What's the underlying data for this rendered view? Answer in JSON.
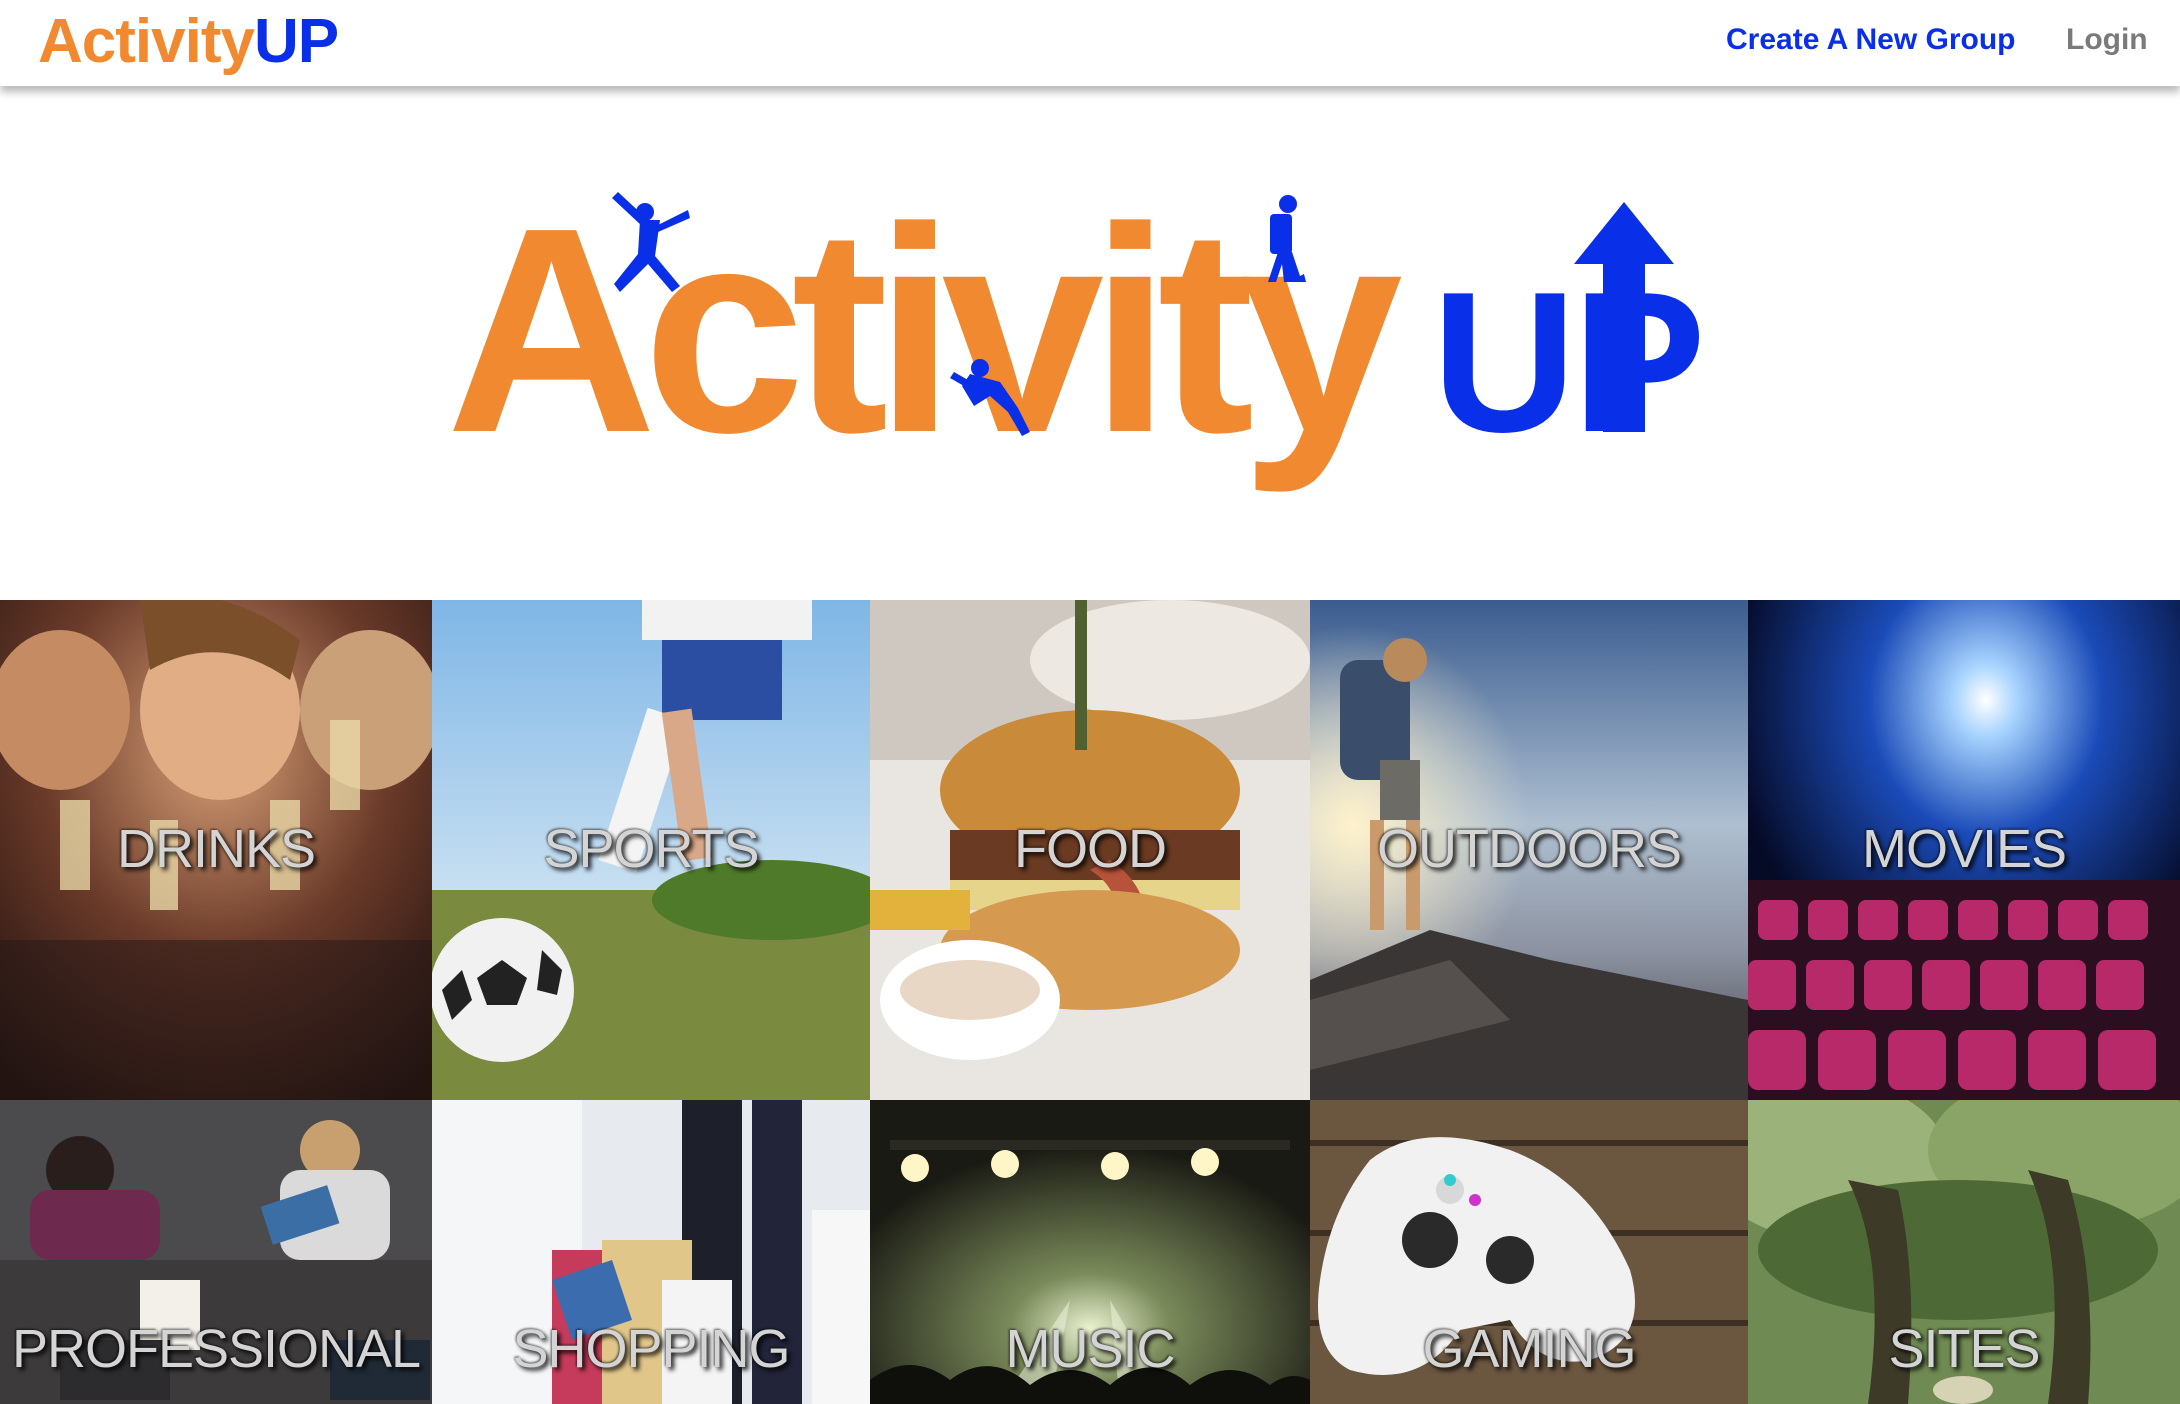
{
  "navbar": {
    "logo_activity": "Activity",
    "logo_up": "UP",
    "create_group": "Create A New Group",
    "login": "Login"
  },
  "hero": {
    "logo_activity": "Activity",
    "logo_up": "UP"
  },
  "colors": {
    "brand_orange": "#f0892f",
    "brand_blue": "#0a2fe8",
    "login_gray": "#7a7a7a"
  },
  "categories": [
    {
      "label": "DRINKS",
      "icon": "drinks-photo"
    },
    {
      "label": "SPORTS",
      "icon": "sports-photo"
    },
    {
      "label": "FOOD",
      "icon": "food-photo"
    },
    {
      "label": "OUTDOORS",
      "icon": "outdoors-photo"
    },
    {
      "label": "MOVIES",
      "icon": "movies-photo"
    },
    {
      "label": "PROFESSIONAL",
      "icon": "professional-photo"
    },
    {
      "label": "SHOPPING",
      "icon": "shopping-photo"
    },
    {
      "label": "MUSIC",
      "icon": "music-photo"
    },
    {
      "label": "GAMING",
      "icon": "gaming-photo"
    },
    {
      "label": "SITES",
      "icon": "sites-photo"
    }
  ]
}
